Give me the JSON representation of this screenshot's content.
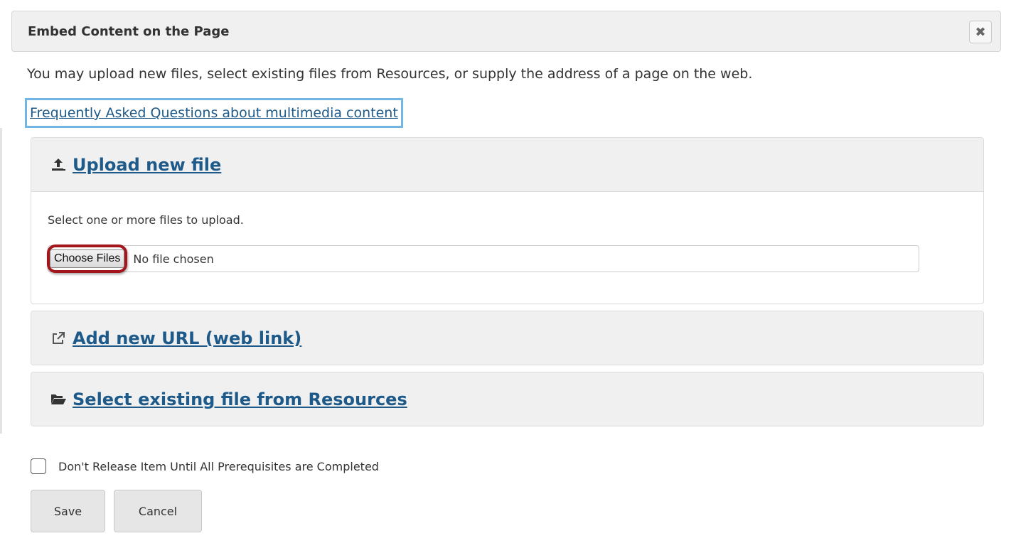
{
  "dialog": {
    "title": "Embed Content on the Page",
    "close_symbol": "✖"
  },
  "intro_text": "You may upload new files, select existing files from Resources, or supply the address of a page on the web.",
  "faq_link": "Frequently Asked Questions about multimedia content",
  "upload": {
    "icon": "upload-icon",
    "title": "Upload new file",
    "instruction": "Select one or more files to upload.",
    "choose_label": "Choose Files",
    "no_file_text": "No file chosen"
  },
  "url": {
    "icon": "external-link-icon",
    "title": "Add new URL (web link)"
  },
  "resources": {
    "icon": "folder-open-icon",
    "title": "Select existing file from Resources"
  },
  "prerequisite": {
    "label": "Don't Release Item Until All Prerequisites are Completed",
    "checked": false
  },
  "actions": {
    "save_label": "Save",
    "cancel_label": "Cancel"
  },
  "colors": {
    "link": "#1d5a8a",
    "highlight_blue": "#74b6e3",
    "highlight_red": "#a3161b",
    "panel_bg": "#f0f0f0"
  }
}
